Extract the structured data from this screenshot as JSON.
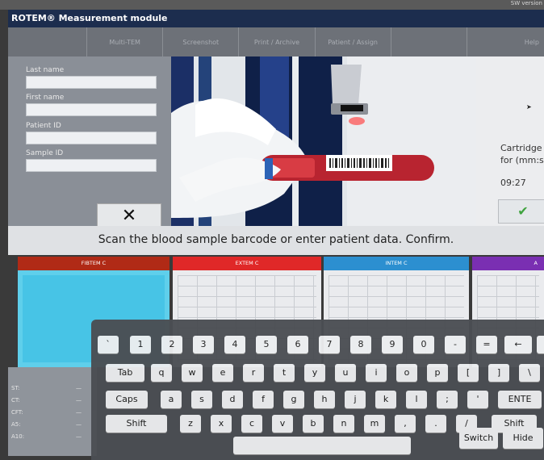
{
  "window": {
    "title": "ROTEM® Measurement module",
    "version_text": "SW version"
  },
  "tabs": [
    {
      "label": "Multi-TEM"
    },
    {
      "label": "Screenshot"
    },
    {
      "label": "Print / Archive"
    },
    {
      "label": "Patient / Assign"
    },
    {
      "label": ""
    },
    {
      "label": "Help"
    }
  ],
  "form": {
    "last_name_label": "Last name",
    "last_name_value": "",
    "first_name_label": "First name",
    "first_name_value": "",
    "patient_id_label": "Patient ID",
    "patient_id_value": "",
    "sample_id_label": "Sample ID",
    "sample_id_value": "",
    "cancel_symbol": "✕"
  },
  "cartridge": {
    "line1": "Cartridge u",
    "line2": "for (mm:ss)",
    "time": "09:27",
    "confirm_symbol": "✔",
    "confirm_color": "#3fa33f"
  },
  "instruction": "Scan the blood sample barcode or enter patient data. Confirm.",
  "tests": [
    {
      "label": "FIBTEM C",
      "color": "#b02a16"
    },
    {
      "label": "EXTEM C",
      "color": "#e02828"
    },
    {
      "label": "INTEM C",
      "color": "#2c8fd0"
    },
    {
      "label": "A",
      "color": "#7a2fb2"
    }
  ],
  "params": [
    {
      "label": "ST:",
      "value": "—"
    },
    {
      "label": "CT:",
      "value": "—"
    },
    {
      "label": "CFT:",
      "value": "—"
    },
    {
      "label": "A5:",
      "value": "—"
    },
    {
      "label": "A10:",
      "value": "—"
    }
  ],
  "keyboard": {
    "row1": [
      "`",
      "1",
      "2",
      "3",
      "4",
      "5",
      "6",
      "7",
      "8",
      "9",
      "0",
      "-",
      "=",
      "←"
    ],
    "row2": [
      "Tab",
      "q",
      "w",
      "e",
      "r",
      "t",
      "y",
      "u",
      "i",
      "o",
      "p",
      "[",
      "]",
      "\\"
    ],
    "row3": [
      "Caps",
      "a",
      "s",
      "d",
      "f",
      "g",
      "h",
      "j",
      "k",
      "l",
      ";",
      "'",
      "ENTE"
    ],
    "row4": [
      "Shift",
      "z",
      "x",
      "c",
      "v",
      "b",
      "n",
      "m",
      ",",
      ".",
      "/",
      "Shift"
    ],
    "row5": [
      "",
      "Switch",
      "Hide"
    ]
  }
}
